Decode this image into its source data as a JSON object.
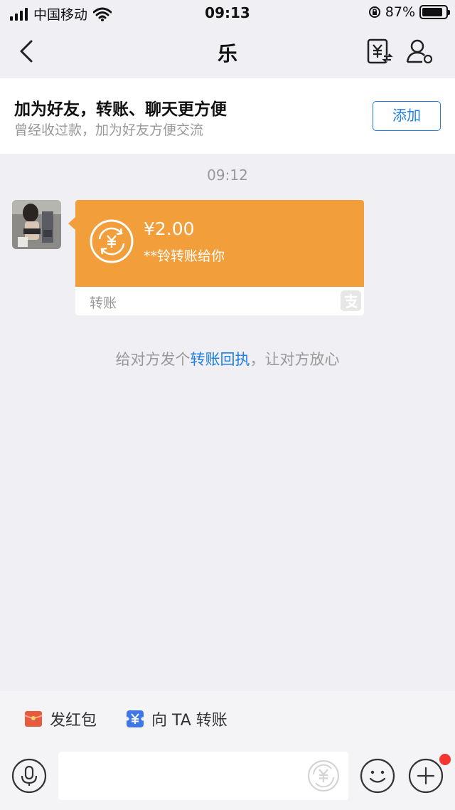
{
  "status_bar": {
    "carrier": "中国移动",
    "time": "09:13",
    "battery_percent": "87%",
    "battery_level": 0.87
  },
  "nav": {
    "title": "乐",
    "back_icon": "chevron-left-icon",
    "transfer_icon": "yen-transfer-icon",
    "profile_icon": "person-settings-icon"
  },
  "banner": {
    "title": "加为好友，转账、聊天更方便",
    "subtitle": "曾经收过款，加为好友方便交流",
    "add_button": "添加"
  },
  "chat": {
    "timestamp": "09:12",
    "transfer": {
      "amount": "¥2.00",
      "description": "**铃转账给你",
      "footer_label": "转账",
      "accent": "#f19e3b"
    },
    "receipt_tip": {
      "before": "给对方发个",
      "link": "转账回执",
      "after": "，让对方放心"
    }
  },
  "shortcuts": {
    "red_packet": "发红包",
    "transfer_to_ta": "向 TA 转账"
  },
  "input_bar": {
    "placeholder": "",
    "mic_icon": "microphone-icon",
    "yen_icon": "yen-icon",
    "emoji_icon": "smiley-icon",
    "plus_icon": "plus-icon"
  },
  "colors": {
    "brand_blue": "#1f7fe0",
    "transfer_orange": "#f19e3b",
    "badge_red": "#f43530"
  }
}
